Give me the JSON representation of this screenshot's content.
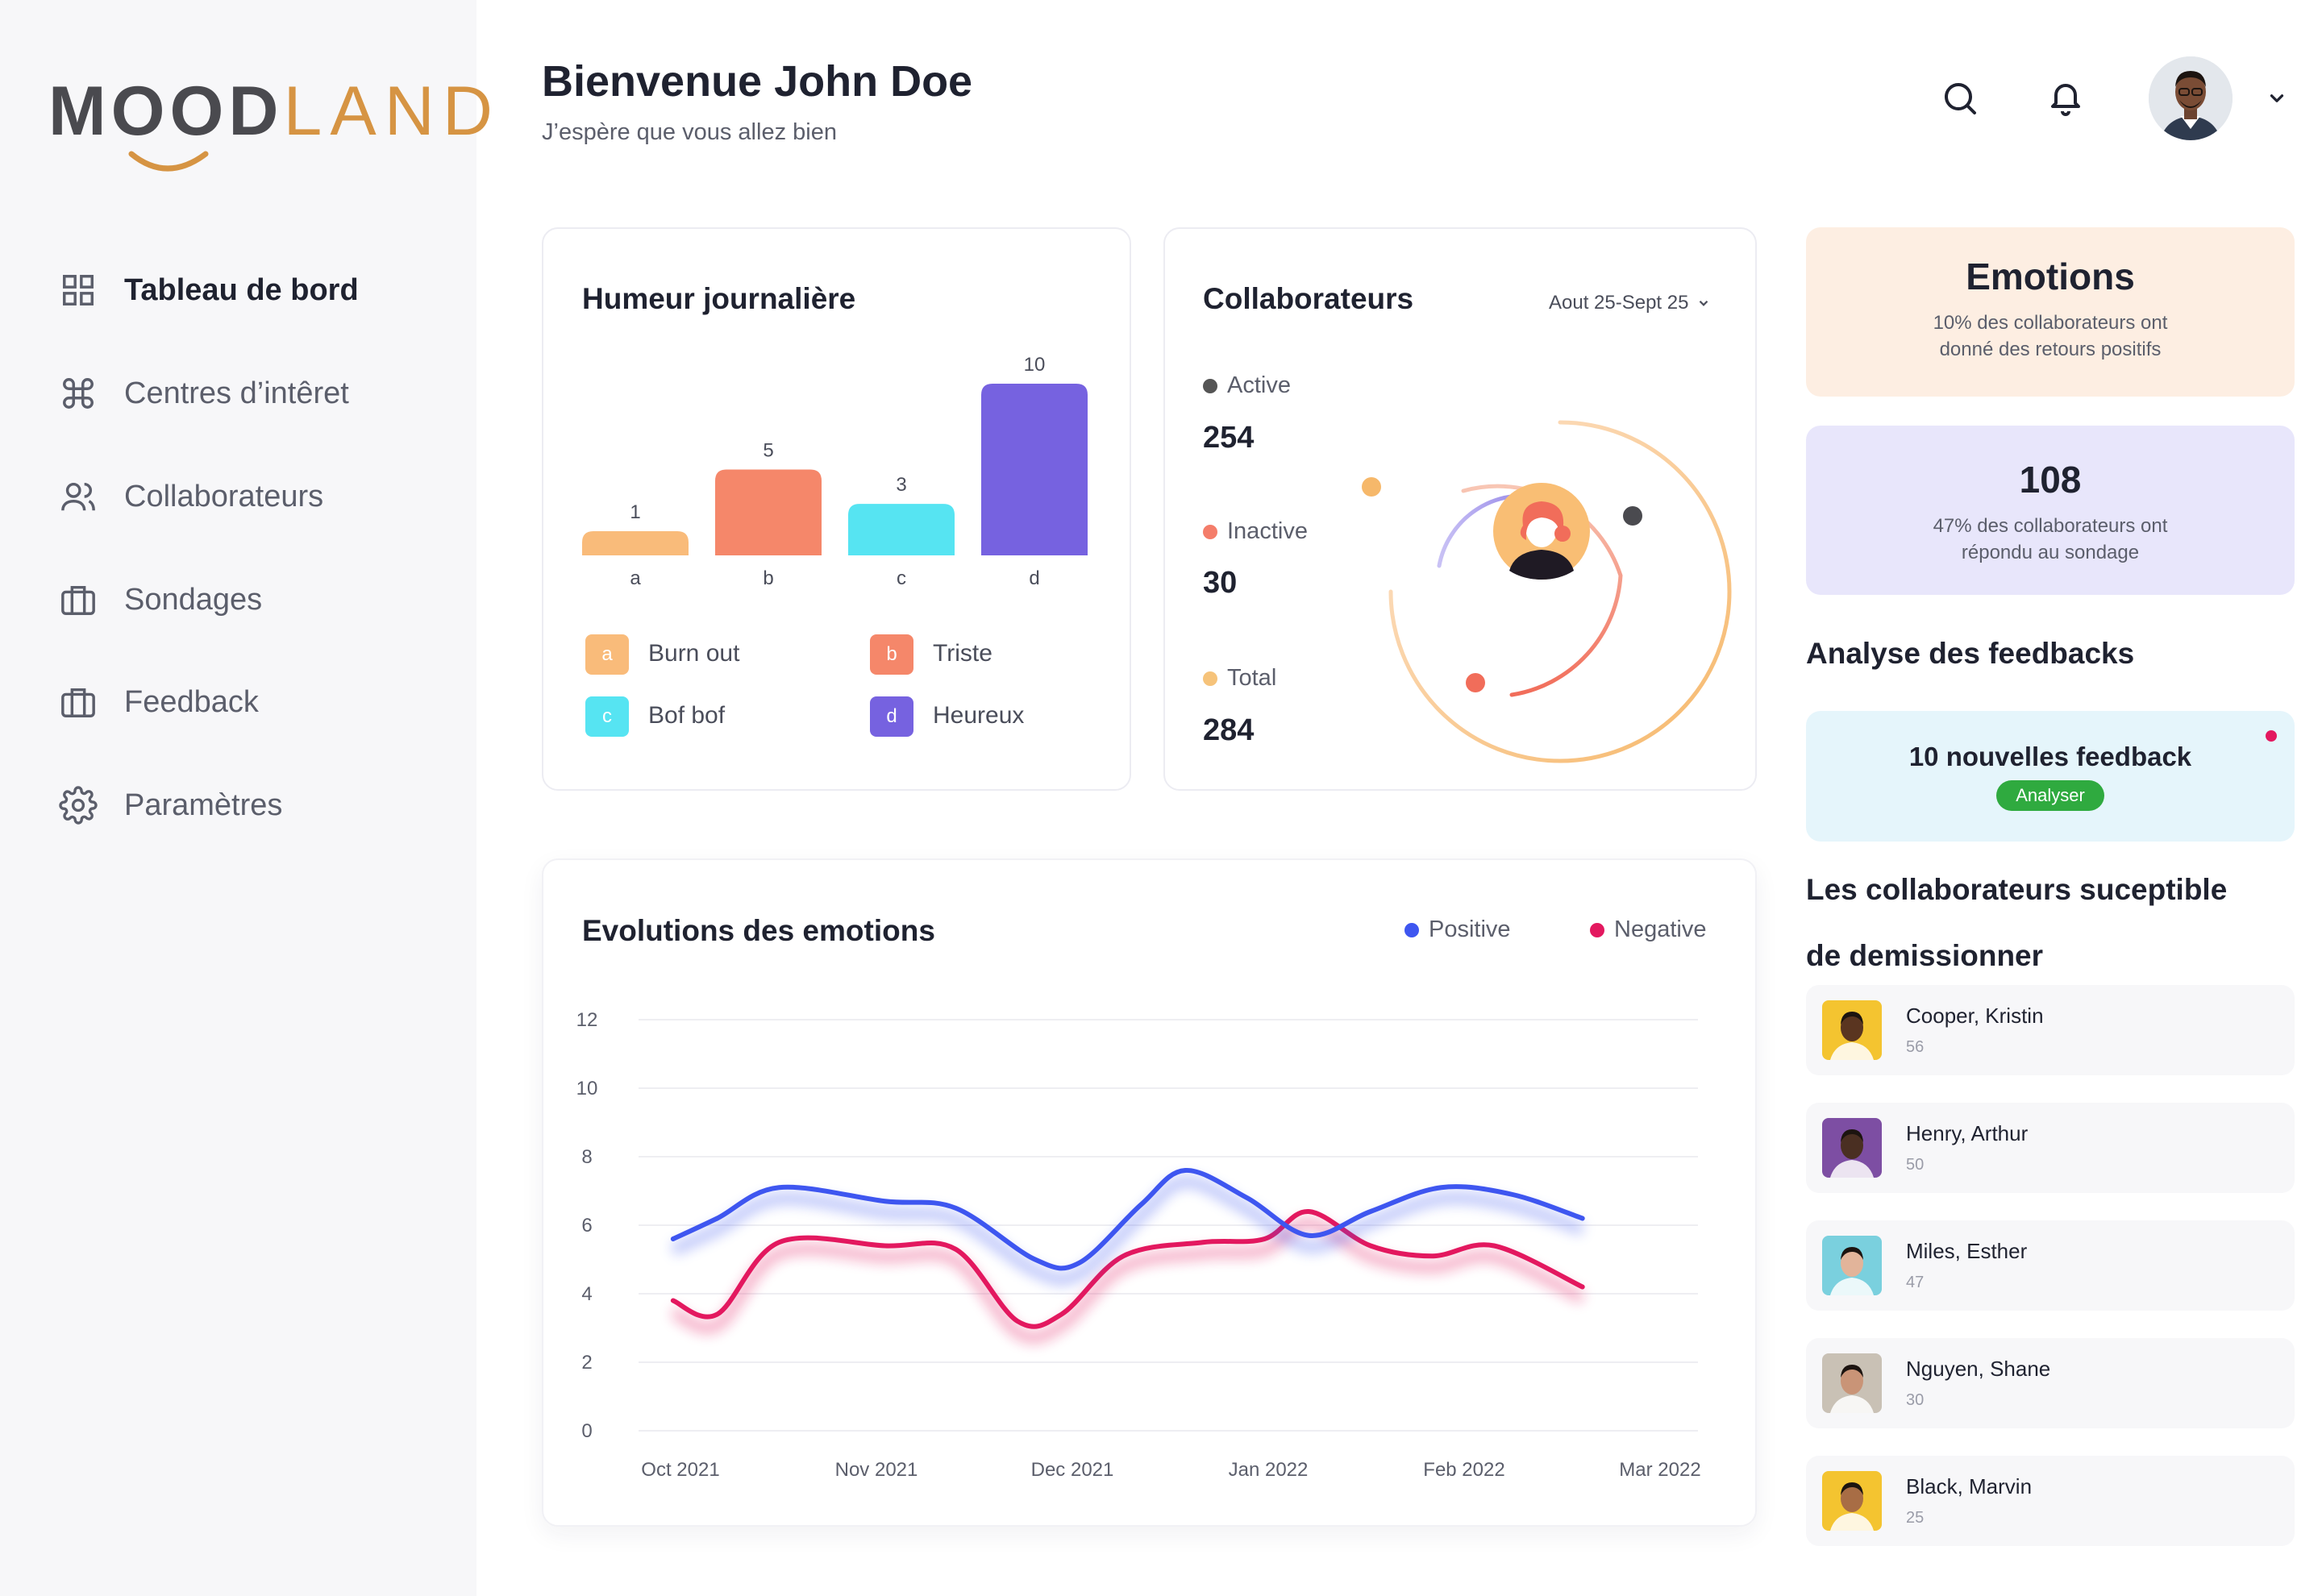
{
  "app": {
    "logo_part1": "MOOD",
    "logo_part2": "LAND",
    "colors": {
      "brand_gray": "#4a4a4f",
      "brand_orange": "#d69443"
    }
  },
  "sidebar": {
    "items": [
      {
        "label": "Tableau de bord",
        "icon": "grid-icon",
        "active": true
      },
      {
        "label": "Centres d’intêret",
        "icon": "command-icon",
        "active": false
      },
      {
        "label": "Collaborateurs",
        "icon": "users-icon",
        "active": false
      },
      {
        "label": "Sondages",
        "icon": "briefcase-icon",
        "active": false
      },
      {
        "label": "Feedback",
        "icon": "briefcase-icon",
        "active": false
      },
      {
        "label": "Paramètres",
        "icon": "gear-icon",
        "active": false
      }
    ]
  },
  "header": {
    "title": "Bienvenue John Doe",
    "subtitle": "J’espère que vous allez bien",
    "icons": [
      "search-icon",
      "bell-icon",
      "chevron-down-icon"
    ]
  },
  "humeur": {
    "title": "Humeur journalière",
    "legend": [
      {
        "key": "a",
        "label": "Burn out",
        "color": "#f9bb7a"
      },
      {
        "key": "b",
        "label": "Triste",
        "color": "#f5876a"
      },
      {
        "key": "c",
        "label": "Bof bof",
        "color": "#56e4f2"
      },
      {
        "key": "d",
        "label": "Heureux",
        "color": "#7662e0"
      }
    ]
  },
  "collab": {
    "title": "Collaborateurs",
    "period": "Aout 25-Sept 25",
    "stats": [
      {
        "label": "Active",
        "value": "254",
        "color": "#555555"
      },
      {
        "label": "Inactive",
        "value": "30",
        "color": "#f47d6a"
      },
      {
        "label": "Total",
        "value": "284",
        "color": "#f6c37a"
      }
    ]
  },
  "right": {
    "emotions": {
      "title": "Emotions",
      "line1": "10% des collaborateurs ont",
      "line2": "donné des retours positifs",
      "bg": "#fdeee2"
    },
    "sondage": {
      "title": "108",
      "line1": "47% des collaborateurs ont",
      "line2": "répondu au sondage",
      "bg": "#e8e6fb"
    },
    "feedback_section": "Analyse des feedbacks",
    "feedback_card": {
      "title": "10 nouvelles feedback",
      "button": "Analyser",
      "bg": "#e5f5fb"
    },
    "risk_title_1": "Les collaborateurs suceptible",
    "risk_title_2": "de demissionner",
    "people": [
      {
        "name": "Cooper, Kristin",
        "score": "56",
        "bg": "#f4c430",
        "skin": "#5a3520"
      },
      {
        "name": "Henry, Arthur",
        "score": "50",
        "bg": "#7d4ea3",
        "skin": "#4a2f22"
      },
      {
        "name": "Miles, Esther",
        "score": "47",
        "bg": "#7ad0de",
        "skin": "#e2b49a"
      },
      {
        "name": "Nguyen, Shane",
        "score": "30",
        "bg": "#c9c1b5",
        "skin": "#c99477"
      },
      {
        "name": "Black, Marvin",
        "score": "25",
        "bg": "#f4c430",
        "skin": "#a86d45"
      }
    ]
  },
  "chart_data": [
    {
      "type": "bar",
      "title": "Humeur journalière",
      "categories": [
        "a",
        "b",
        "c",
        "d"
      ],
      "values": [
        1,
        5,
        3,
        10
      ],
      "colors": [
        "#f9bb7a",
        "#f5876a",
        "#56e4f2",
        "#7662e0"
      ]
    },
    {
      "type": "line",
      "title": "Evolutions des emotions",
      "x": [
        "Oct 2021",
        "Nov 2021",
        "Dec 2021",
        "Jan 2022",
        "Feb 2022",
        "Mar 2022"
      ],
      "ylim": [
        0,
        12
      ],
      "yticks": [
        0,
        2,
        4,
        6,
        8,
        10,
        12
      ],
      "grid": true,
      "legend": "top-right",
      "series": [
        {
          "name": "Positive",
          "color": "#3e56f0",
          "points": [
            [
              0.15,
              5.6
            ],
            [
              0.4,
              6.2
            ],
            [
              0.75,
              7.1
            ],
            [
              1.35,
              6.7
            ],
            [
              1.75,
              6.5
            ],
            [
              2.2,
              5.0
            ],
            [
              2.45,
              4.9
            ],
            [
              2.8,
              6.6
            ],
            [
              3.05,
              7.6
            ],
            [
              3.4,
              6.8
            ],
            [
              3.75,
              5.7
            ],
            [
              4.1,
              6.4
            ],
            [
              4.5,
              7.1
            ],
            [
              4.9,
              6.9
            ],
            [
              5.3,
              6.2
            ]
          ]
        },
        {
          "name": "Negative",
          "color": "#e3185f",
          "points": [
            [
              0.15,
              3.8
            ],
            [
              0.4,
              3.4
            ],
            [
              0.75,
              5.5
            ],
            [
              1.35,
              5.4
            ],
            [
              1.75,
              5.3
            ],
            [
              2.1,
              3.2
            ],
            [
              2.35,
              3.4
            ],
            [
              2.7,
              5.1
            ],
            [
              3.15,
              5.5
            ],
            [
              3.5,
              5.6
            ],
            [
              3.75,
              6.4
            ],
            [
              4.1,
              5.4
            ],
            [
              4.45,
              5.1
            ],
            [
              4.8,
              5.4
            ],
            [
              5.3,
              4.2
            ]
          ]
        }
      ]
    }
  ]
}
